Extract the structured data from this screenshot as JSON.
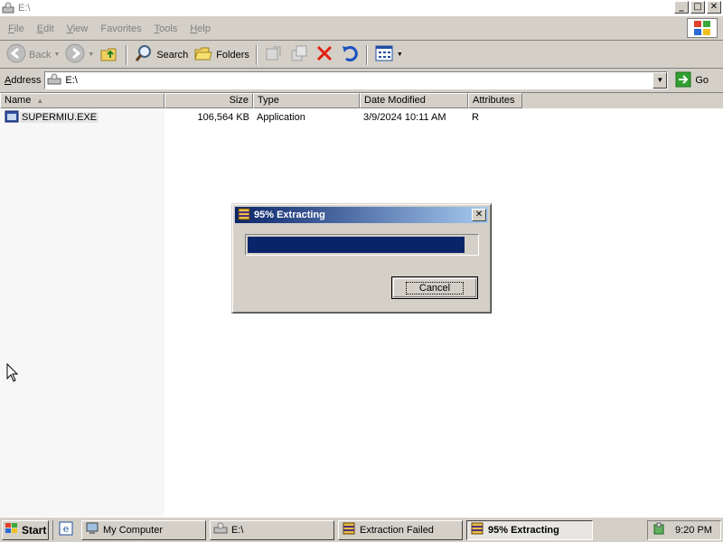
{
  "window": {
    "title": "E:\\",
    "buttons": {
      "minimize": "_",
      "maximize": "□",
      "close": "✕"
    }
  },
  "menubar": {
    "items": [
      {
        "label": "File",
        "accel": "F",
        "rest": "ile"
      },
      {
        "label": "Edit",
        "accel": "E",
        "rest": "dit"
      },
      {
        "label": "View",
        "accel": "V",
        "rest": "iew"
      },
      {
        "label": "Favorites",
        "accel": "",
        "rest": "Favorites"
      },
      {
        "label": "Tools",
        "accel": "T",
        "rest": "ools"
      },
      {
        "label": "Help",
        "accel": "H",
        "rest": "elp"
      }
    ]
  },
  "toolbar": {
    "back_label": "Back",
    "search_label": "Search",
    "folders_label": "Folders"
  },
  "address": {
    "label_accel": "A",
    "label_rest": "ddress",
    "value": "E:\\",
    "go_label": "Go"
  },
  "filelist": {
    "columns": [
      "Name",
      "Size",
      "Type",
      "Date Modified",
      "Attributes"
    ],
    "rows": [
      {
        "name": "SUPERMIU.EXE",
        "size": "106,564 KB",
        "type": "Application",
        "modified": "3/9/2024 10:11 AM",
        "attributes": "R"
      }
    ]
  },
  "dialog": {
    "title": "95% Extracting",
    "progress_percent": 95,
    "cancel_label": "Cancel",
    "close_glyph": "✕"
  },
  "taskbar": {
    "start_label": "Start",
    "tasks": [
      {
        "label": "My Computer",
        "active": false
      },
      {
        "label": "E:\\",
        "active": false
      },
      {
        "label": "Extraction Failed",
        "active": false
      },
      {
        "label": "95% Extracting",
        "active": true
      }
    ],
    "clock": "9:20 PM"
  },
  "colors": {
    "titlebar_active": "#0a246a",
    "titlebar_gradient_end": "#a6caf0",
    "progress_fill": "#0a246a",
    "window_face": "#d4d0c8"
  }
}
